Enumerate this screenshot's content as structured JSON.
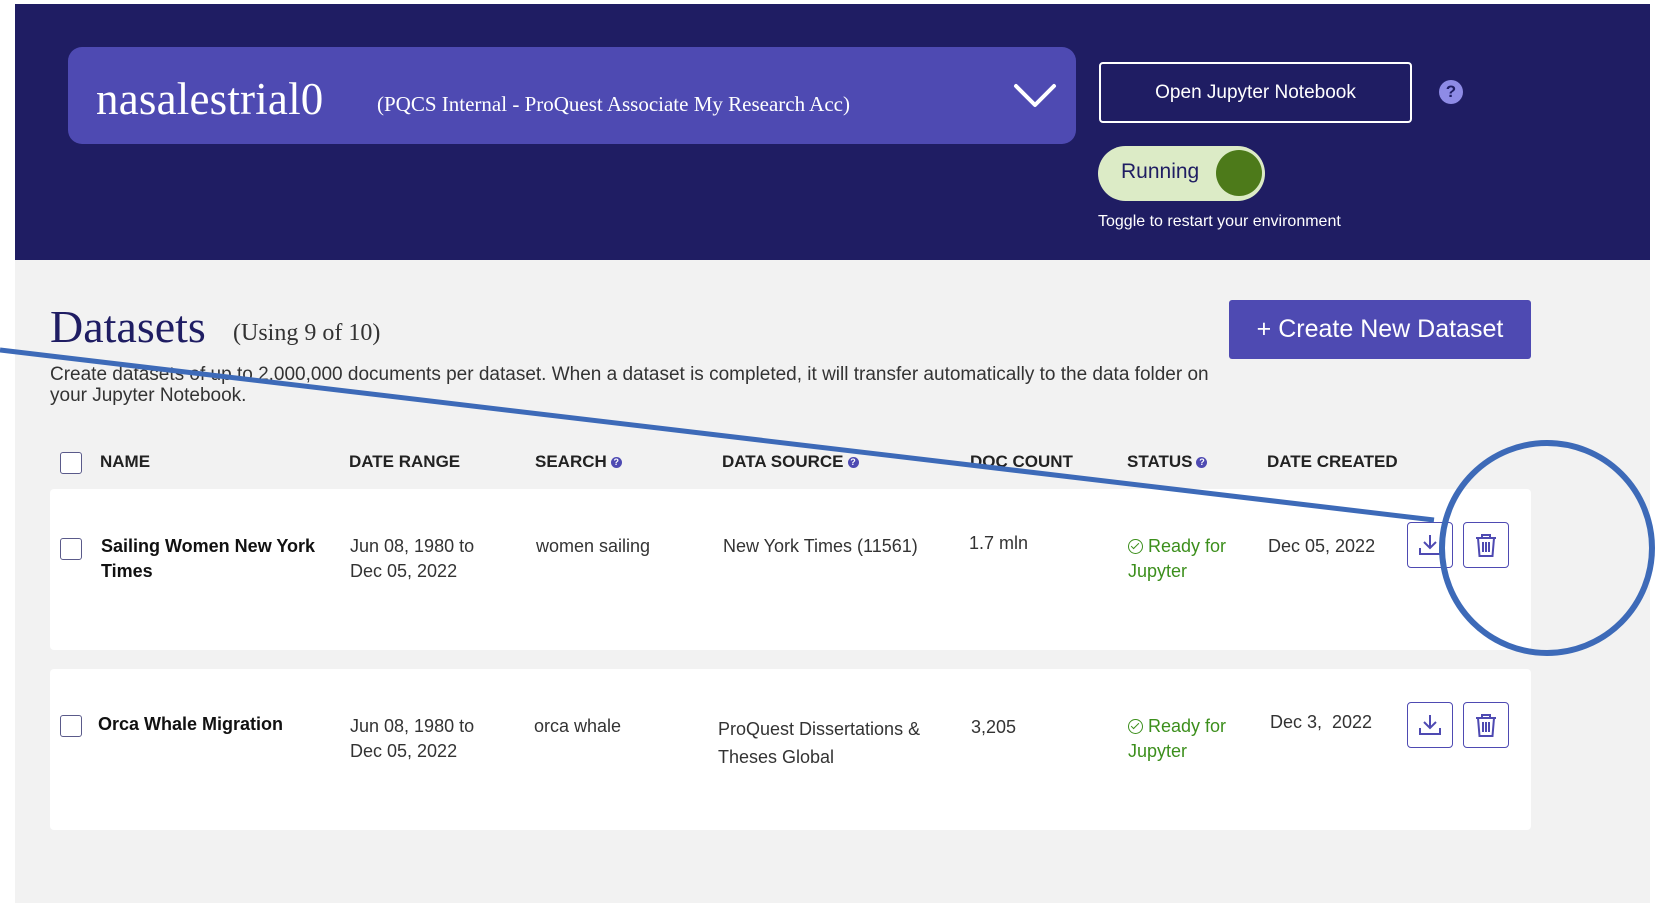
{
  "header": {
    "account_name": "nasalestrial0",
    "account_desc": "(PQCS Internal - ProQuest Associate My Research Acc)",
    "open_jupyter_label": "Open Jupyter Notebook",
    "help_glyph": "?",
    "toggle_label": "Running",
    "toggle_state": "on",
    "toggle_hint": "Toggle to restart your environment"
  },
  "datasets": {
    "title": "Datasets",
    "usage": "(Using 9 of 10)",
    "create_label": "+ Create New Dataset",
    "description": "Create datasets of up to 2,000,000 documents per dataset. When a dataset is completed, it will transfer automatically to the data folder on your Jupyter Notebook."
  },
  "table": {
    "columns": [
      "NAME",
      "DATE RANGE",
      "SEARCH",
      "DATA SOURCE",
      "DOC COUNT",
      "STATUS",
      "DATE CREATED"
    ],
    "help_glyph": "?",
    "rows": [
      {
        "name": "Sailing Women New York Times",
        "date_range": "Jun 08, 1980 to Dec 05, 2022",
        "search": "women sailing",
        "data_source": "New York Times (11561)",
        "doc_count": "1.7 mln",
        "status": "Ready for Jupyter",
        "date_created": "Dec 05, 2022"
      },
      {
        "name": "Orca Whale Migration",
        "date_range": "Jun 08, 1980 to Dec 05, 2022",
        "search": "orca whale",
        "data_source": "ProQuest Dissertations & Theses Global",
        "doc_count": "3,205",
        "status": "Ready for Jupyter",
        "date_created": "Dec 3,  2022"
      }
    ]
  },
  "icons": {
    "dropdown": "chevron-down-icon",
    "help": "help-icon",
    "download": "download-icon",
    "delete": "trash-icon",
    "status": "check-circle-icon"
  },
  "colors": {
    "header_bg": "#1f1d63",
    "accent": "#4e4ab2",
    "status_ready": "#3c8f1c",
    "toggle_on": "#4d7a1a",
    "annotation": "#3d6ab8"
  }
}
